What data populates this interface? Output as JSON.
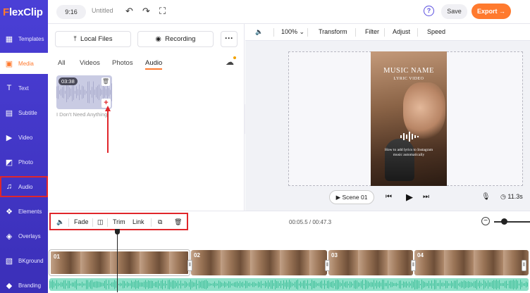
{
  "brand": {
    "logo_prefix": "F",
    "logo_rest": "lexClip"
  },
  "sidebar": {
    "items": [
      {
        "id": "templates",
        "label": "Templates",
        "icon": "templates-icon"
      },
      {
        "id": "media",
        "label": "Media",
        "icon": "media-icon"
      },
      {
        "id": "text",
        "label": "Text",
        "icon": "text-icon"
      },
      {
        "id": "subtitle",
        "label": "Subtitle",
        "icon": "subtitle-icon"
      },
      {
        "id": "video",
        "label": "Video",
        "icon": "video-icon"
      },
      {
        "id": "photo",
        "label": "Photo",
        "icon": "photo-icon"
      },
      {
        "id": "audio",
        "label": "Audio",
        "icon": "music-note-icon"
      },
      {
        "id": "elements",
        "label": "Elements",
        "icon": "elements-icon"
      },
      {
        "id": "overlays",
        "label": "Overlays",
        "icon": "overlays-icon"
      },
      {
        "id": "bkground",
        "label": "BKground",
        "icon": "background-icon"
      },
      {
        "id": "branding",
        "label": "Branding",
        "icon": "branding-icon"
      }
    ],
    "active": "media",
    "highlighted": "audio"
  },
  "topbar": {
    "ratio": "9:16",
    "title": "Untitled",
    "help": "?",
    "save": "Save",
    "export": "Export →"
  },
  "media_panel": {
    "local_files": "Local Files",
    "recording": "Recording",
    "more": "···",
    "tabs": [
      "All",
      "Videos",
      "Photos",
      "Audio"
    ],
    "active_tab": "Audio",
    "audio_item": {
      "duration": "03:38",
      "name": "I Don't Need Anything",
      "add": "+"
    }
  },
  "preview": {
    "toolbar": {
      "zoom": "100%",
      "transform": "Transform",
      "filter": "Filter",
      "adjust": "Adjust",
      "speed": "Speed"
    },
    "video": {
      "title": "MUSIC NAME",
      "subtitle": "LYRIC VIDEO",
      "description": "How to add lyrics to Instagram music automatically"
    },
    "scene": "Scene 01",
    "duration": "11.3s"
  },
  "timeline_toolbar": {
    "fade": "Fade",
    "trim": "Trim",
    "link": "Link",
    "time": "00:05.5 / 00:47.3"
  },
  "timeline": {
    "clips": [
      {
        "num": "01",
        "handle": "‖"
      },
      {
        "num": "02",
        "handle": "‖"
      },
      {
        "num": "03",
        "handle": "‖"
      },
      {
        "num": "04",
        "handle": "‖"
      }
    ]
  },
  "colors": {
    "accent": "#ff7a2e",
    "sidebar": "#4a3fd6",
    "highlight": "#e0262b",
    "audio_track": "#8ee0c8"
  }
}
